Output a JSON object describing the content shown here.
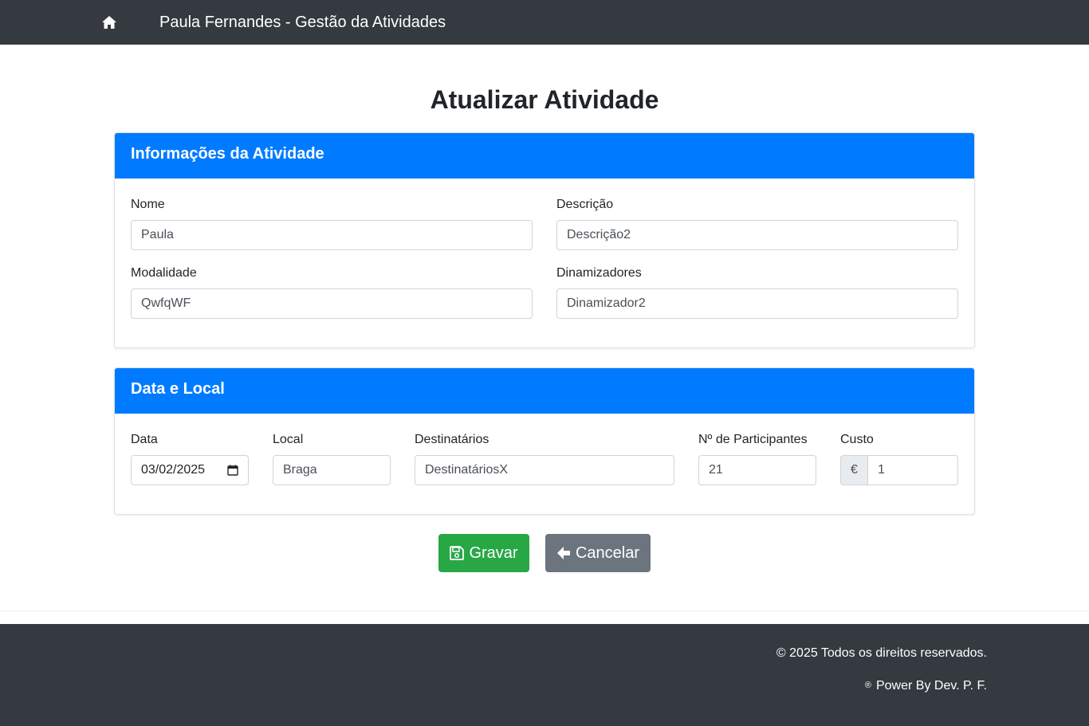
{
  "navbar": {
    "home_icon": "home-icon",
    "brand": "Paula Fernandes - Gestão da Atividades"
  },
  "page": {
    "title": "Atualizar Atividade"
  },
  "info_section": {
    "header": "Informações da Atividade",
    "fields": {
      "nome": {
        "label": "Nome",
        "value": "Paula"
      },
      "descricao": {
        "label": "Descrição",
        "value": "Descrição2"
      },
      "modalidade": {
        "label": "Modalidade",
        "value": "QwfqWF"
      },
      "dinamizadores": {
        "label": "Dinamizadores",
        "value": "Dinamizador2"
      }
    }
  },
  "date_section": {
    "header": "Data e Local",
    "fields": {
      "data": {
        "label": "Data",
        "value": "03/02/2025"
      },
      "local": {
        "label": "Local",
        "value": "Braga"
      },
      "destinatarios": {
        "label": "Destinatários",
        "value": "DestinatáriosX"
      },
      "participantes": {
        "label": "Nº de Participantes",
        "value": "21"
      },
      "custo": {
        "label": "Custo",
        "currency": "€",
        "value": "1"
      }
    }
  },
  "actions": {
    "save_label": "Gravar",
    "cancel_label": "Cancelar"
  },
  "footer": {
    "copyright": "© 2025 Todos os direitos reservados.",
    "registered_mark": "®",
    "powered_by": "Power By Dev. P. F."
  },
  "colors": {
    "navbar": "#343a40",
    "card_header": "#007bff",
    "save_button": "#28a745",
    "cancel_button": "#6c757d"
  }
}
